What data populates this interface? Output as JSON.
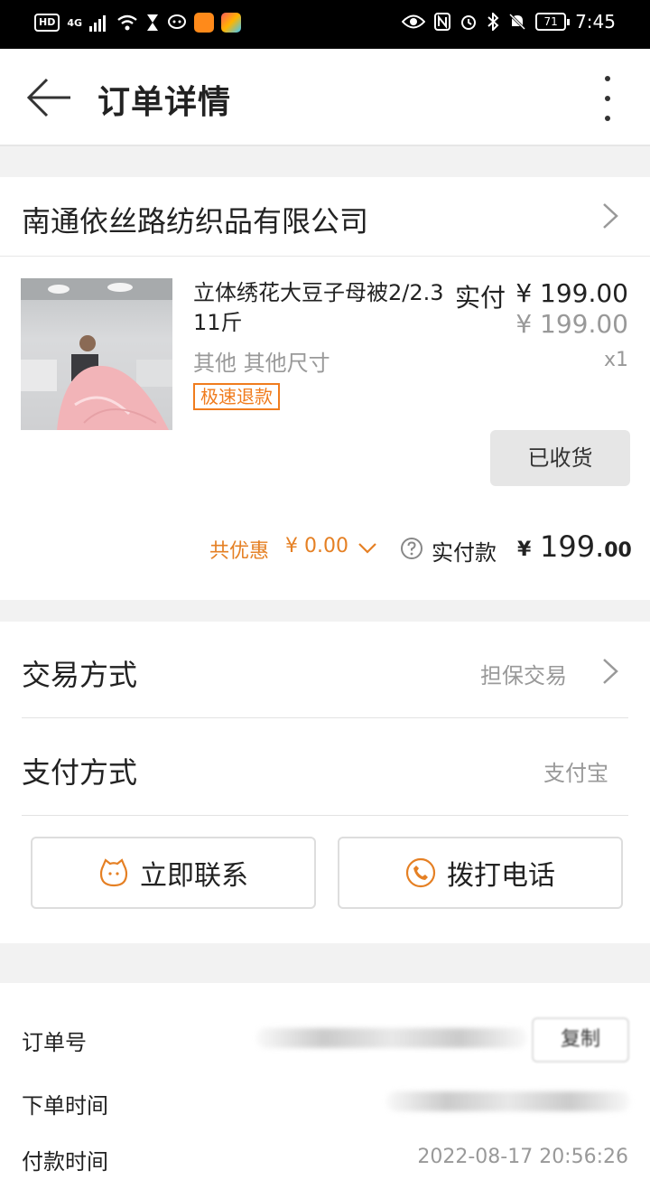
{
  "status_bar": {
    "left_badges": [
      "HD",
      "4G"
    ],
    "time": "7:45",
    "battery": "71"
  },
  "header": {
    "title": "订单详情"
  },
  "shop": {
    "name": "南通依丝路纺织品有限公司"
  },
  "product": {
    "title": "立体绣花大豆子母被2/2.3 11斤",
    "price_label": "实付",
    "price": "¥ 199.00",
    "original_price": "¥ 199.00",
    "spec": "其他 其他尺寸",
    "quantity": "x1",
    "tag": "极速退款",
    "status_button": "已收货"
  },
  "summary": {
    "discount_label": "共优惠",
    "discount_value": "¥ 0.00",
    "paid_label": "实付款",
    "paid_currency": "¥",
    "paid_int": "199.",
    "paid_dec": "00"
  },
  "trade": {
    "method_label": "交易方式",
    "method_value": "担保交易",
    "payment_label": "支付方式",
    "payment_value": "支付宝",
    "contact_button": "立即联系",
    "call_button": "拨打电话"
  },
  "order_info": {
    "order_no_label": "订单号",
    "copy_button": "复制",
    "created_label": "下单时间",
    "paid_time_label": "付款时间",
    "paid_time_value": "2022-08-17 20:56:26"
  },
  "colors": {
    "accent": "#e58024",
    "tag": "#f07c1e",
    "muted": "#999999"
  }
}
